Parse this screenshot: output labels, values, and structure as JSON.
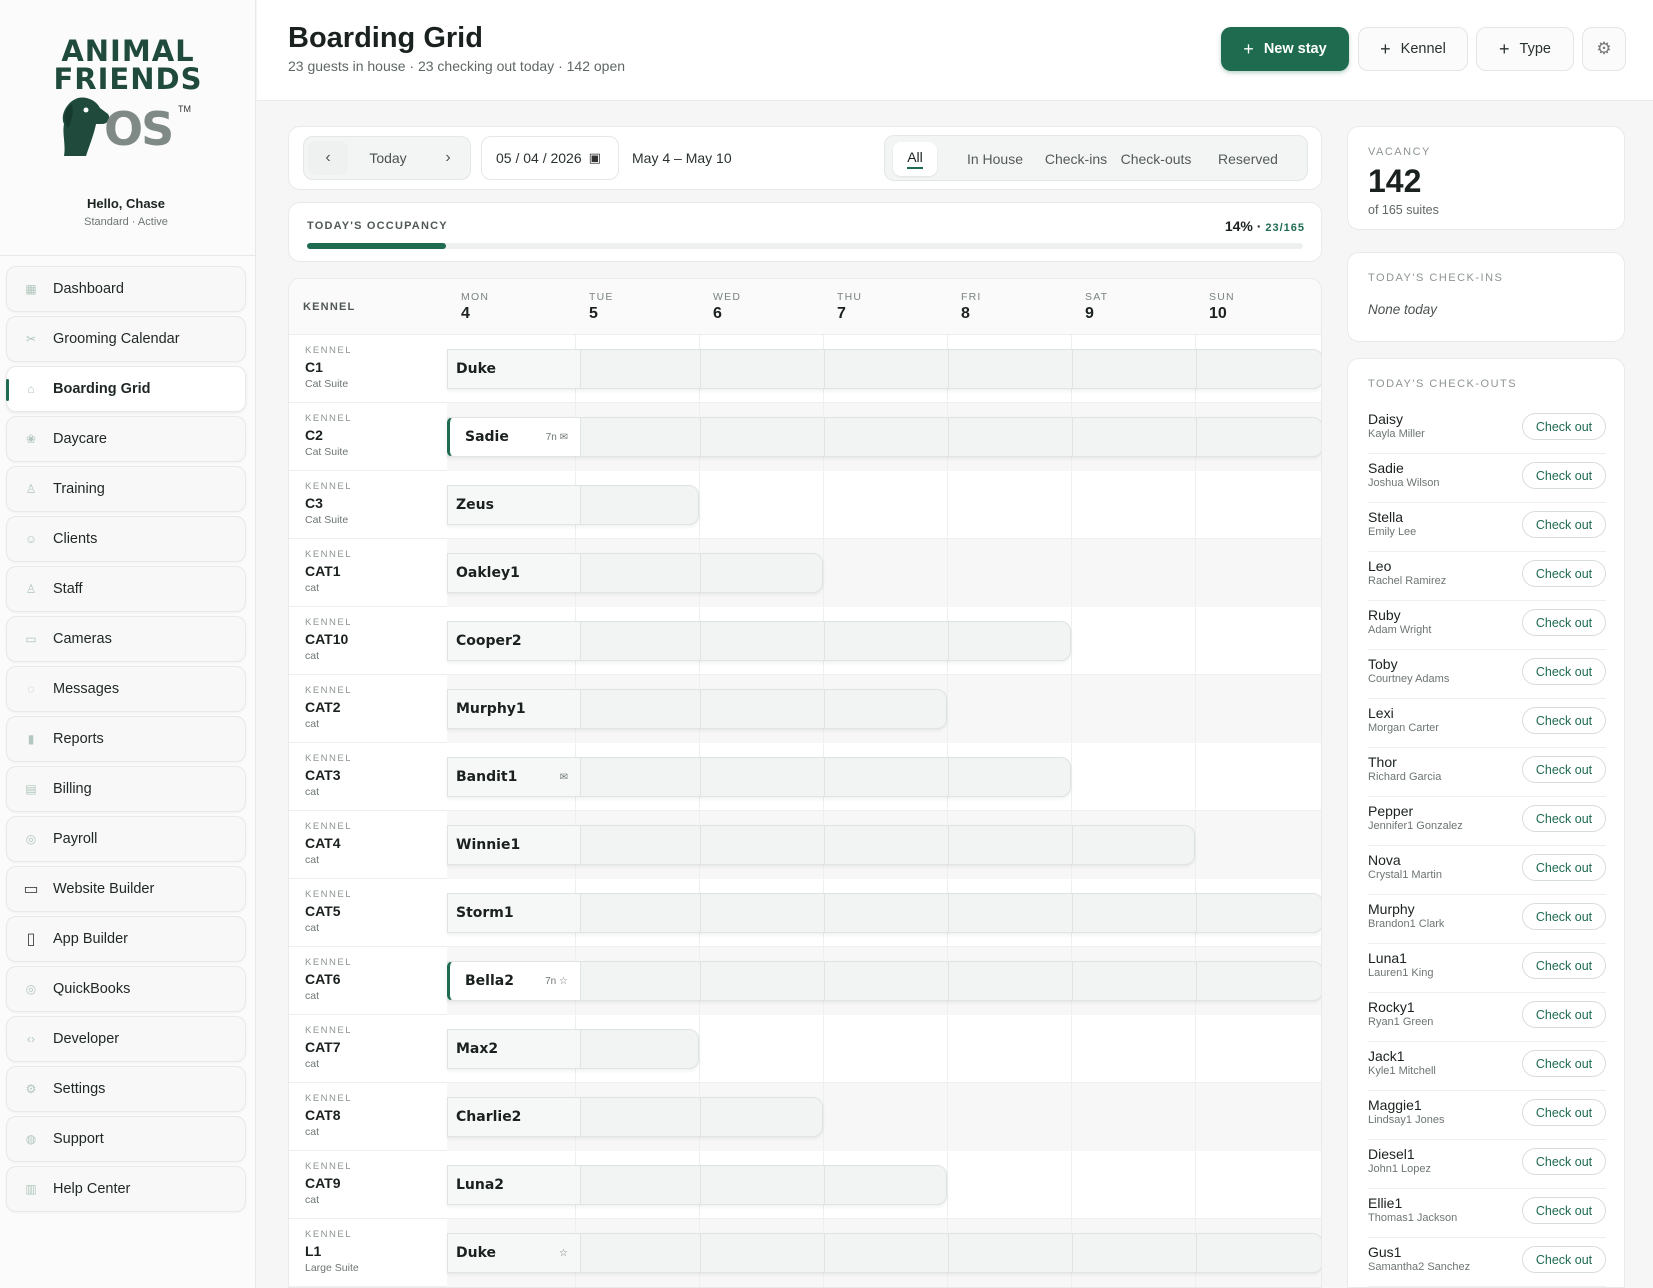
{
  "brand": {
    "line1": "ANIMAL",
    "line2": "FRIENDS",
    "os": "OS",
    "tm": "TM"
  },
  "user": {
    "greeting": "Hello, Chase",
    "status": "Standard · Active"
  },
  "nav": [
    {
      "label": "Dashboard",
      "icon": "dashboard-icon"
    },
    {
      "label": "Grooming Calendar",
      "icon": "scissors-icon"
    },
    {
      "label": "Boarding Grid",
      "icon": "home-icon",
      "active": true
    },
    {
      "label": "Daycare",
      "icon": "paw-icon"
    },
    {
      "label": "Training",
      "icon": "training-icon"
    },
    {
      "label": "Clients",
      "icon": "clients-icon"
    },
    {
      "label": "Staff",
      "icon": "staff-icon"
    },
    {
      "label": "Cameras",
      "icon": "camera-icon"
    },
    {
      "label": "Messages",
      "icon": "message-icon"
    },
    {
      "label": "Reports",
      "icon": "reports-icon"
    },
    {
      "label": "Billing",
      "icon": "billing-icon"
    },
    {
      "label": "Payroll",
      "icon": "payroll-icon"
    },
    {
      "label": "Website Builder",
      "icon": "browser-icon"
    },
    {
      "label": "App Builder",
      "icon": "phone-icon"
    },
    {
      "label": "QuickBooks",
      "icon": "quickbooks-icon"
    },
    {
      "label": "Developer",
      "icon": "code-icon"
    },
    {
      "label": "Settings",
      "icon": "gear-icon"
    },
    {
      "label": "Support",
      "icon": "support-icon"
    },
    {
      "label": "Help Center",
      "icon": "book-icon"
    }
  ],
  "header": {
    "title": "Boarding Grid",
    "subtitle": "23 guests in house · 23 checking out today · 142 open",
    "new_stay": "New stay",
    "kennel": "Kennel",
    "type": "Type"
  },
  "toolbar": {
    "today": "Today",
    "date": "05 / 04 / 2026",
    "range": "May 4 – May 10",
    "filters": [
      "All",
      "In House",
      "Check-ins",
      "Check-outs",
      "Reserved"
    ],
    "active_filter": "All"
  },
  "occupancy": {
    "label": "TODAY'S OCCUPANCY",
    "percent": "14%",
    "count": "23/165",
    "fraction": 0.14
  },
  "grid": {
    "kennel_header": "KENNEL",
    "kennel_prefix": "KENNEL",
    "days": [
      {
        "dow": "MON",
        "num": "4"
      },
      {
        "dow": "TUE",
        "num": "5"
      },
      {
        "dow": "WED",
        "num": "6"
      },
      {
        "dow": "THU",
        "num": "7"
      },
      {
        "dow": "FRI",
        "num": "8"
      },
      {
        "dow": "SAT",
        "num": "9"
      },
      {
        "dow": "SUN",
        "num": "10"
      }
    ],
    "rows": [
      {
        "kennel": "C1",
        "type": "Cat Suite",
        "pet": "Duke",
        "days": 7,
        "nights": "",
        "icon": ""
      },
      {
        "kennel": "C2",
        "type": "Cat Suite",
        "pet": "Sadie",
        "days": 7,
        "nights": "7n",
        "icon": "✉",
        "accent": true
      },
      {
        "kennel": "C3",
        "type": "Cat Suite",
        "pet": "Zeus",
        "days": 2,
        "nights": "",
        "icon": ""
      },
      {
        "kennel": "CAT1",
        "type": "cat",
        "pet": "Oakley1",
        "days": 3,
        "nights": "",
        "icon": ""
      },
      {
        "kennel": "CAT10",
        "type": "cat",
        "pet": "Cooper2",
        "days": 5,
        "nights": "",
        "icon": ""
      },
      {
        "kennel": "CAT2",
        "type": "cat",
        "pet": "Murphy1",
        "days": 4,
        "nights": "",
        "icon": ""
      },
      {
        "kennel": "CAT3",
        "type": "cat",
        "pet": "Bandit1",
        "days": 5,
        "nights": "",
        "icon": "✉"
      },
      {
        "kennel": "CAT4",
        "type": "cat",
        "pet": "Winnie1",
        "days": 6,
        "nights": "",
        "icon": ""
      },
      {
        "kennel": "CAT5",
        "type": "cat",
        "pet": "Storm1",
        "days": 7,
        "nights": "",
        "icon": ""
      },
      {
        "kennel": "CAT6",
        "type": "cat",
        "pet": "Bella2",
        "days": 7,
        "nights": "7n",
        "icon": "☆",
        "accent": true
      },
      {
        "kennel": "CAT7",
        "type": "cat",
        "pet": "Max2",
        "days": 2,
        "nights": "",
        "icon": ""
      },
      {
        "kennel": "CAT8",
        "type": "cat",
        "pet": "Charlie2",
        "days": 3,
        "nights": "",
        "icon": ""
      },
      {
        "kennel": "CAT9",
        "type": "cat",
        "pet": "Luna2",
        "days": 4,
        "nights": "",
        "icon": ""
      },
      {
        "kennel": "L1",
        "type": "Large Suite",
        "pet": "Duke",
        "days": 7,
        "nights": "",
        "icon": "☆"
      }
    ]
  },
  "vacancy": {
    "label": "VACANCY",
    "value": "142",
    "sub": "of 165 suites"
  },
  "checkins": {
    "label": "TODAY'S CHECK-INS",
    "empty": "None today"
  },
  "checkouts": {
    "label": "TODAY'S CHECK-OUTS",
    "button": "Check out",
    "items": [
      {
        "pet": "Daisy",
        "owner": "Kayla Miller"
      },
      {
        "pet": "Sadie",
        "owner": "Joshua Wilson"
      },
      {
        "pet": "Stella",
        "owner": "Emily Lee"
      },
      {
        "pet": "Leo",
        "owner": "Rachel Ramirez"
      },
      {
        "pet": "Ruby",
        "owner": "Adam Wright"
      },
      {
        "pet": "Toby",
        "owner": "Courtney Adams"
      },
      {
        "pet": "Lexi",
        "owner": "Morgan Carter"
      },
      {
        "pet": "Thor",
        "owner": "Richard Garcia"
      },
      {
        "pet": "Pepper",
        "owner": "Jennifer1 Gonzalez"
      },
      {
        "pet": "Nova",
        "owner": "Crystal1 Martin"
      },
      {
        "pet": "Murphy",
        "owner": "Brandon1 Clark"
      },
      {
        "pet": "Luna1",
        "owner": "Lauren1 King"
      },
      {
        "pet": "Rocky1",
        "owner": "Ryan1 Green"
      },
      {
        "pet": "Jack1",
        "owner": "Kyle1 Mitchell"
      },
      {
        "pet": "Maggie1",
        "owner": "Lindsay1 Jones"
      },
      {
        "pet": "Diesel1",
        "owner": "John1 Lopez"
      },
      {
        "pet": "Ellie1",
        "owner": "Thomas1 Jackson"
      },
      {
        "pet": "Gus1",
        "owner": "Samantha2 Sanchez"
      }
    ]
  },
  "colors": {
    "accent": "#1e6b4f",
    "bg": "#f5f6f5"
  }
}
